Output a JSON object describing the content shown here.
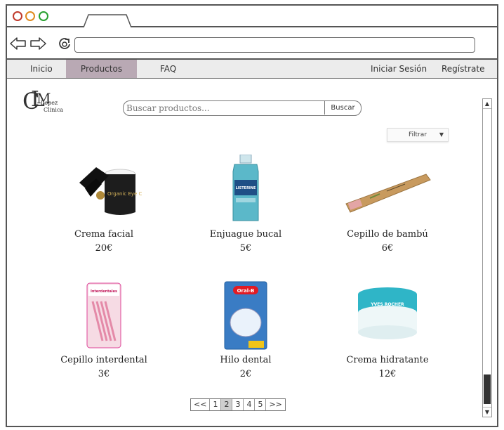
{
  "browser": {
    "url": ""
  },
  "menu": {
    "items": [
      "Inicio",
      "Productos",
      "FAQ"
    ],
    "right_items": [
      "Iniciar Sesión",
      "Regístrate"
    ]
  },
  "logo": {
    "letters": [
      "C",
      "L",
      "M"
    ],
    "words": [
      "Lopez",
      "Clinica"
    ]
  },
  "search": {
    "placeholder": "Buscar productos...",
    "button_label": "Buscar"
  },
  "filter": {
    "label": "Filtrar"
  },
  "products": [
    {
      "name": "Crema facial",
      "price": "20€",
      "image_text": "Organic Eye Cream"
    },
    {
      "name": "Enjuague bucal",
      "price": "5€",
      "image_text": "LISTERINE"
    },
    {
      "name": "Cepillo de bambú",
      "price": "6€",
      "image_text": ""
    },
    {
      "name": "Cepillo interdental",
      "price": "3€",
      "image_text": "Interdentales"
    },
    {
      "name": "Hilo dental",
      "price": "2€",
      "image_text": "Oral-B"
    },
    {
      "name": "Crema hidratante",
      "price": "12€",
      "image_text": "YVES ROCHER"
    }
  ],
  "pagination": {
    "first": "<<",
    "pages": [
      "1",
      "2",
      "3",
      "4",
      "5"
    ],
    "current": "2",
    "last": ">>"
  },
  "colors": {
    "active_menu": "#b9a9b4",
    "menu_bg": "#ececec",
    "mouthwash": "#5bb8c9",
    "floss_blue": "#2a6db5",
    "interdental_pink": "#e48aa8",
    "cream_teal": "#2fb5c7"
  }
}
